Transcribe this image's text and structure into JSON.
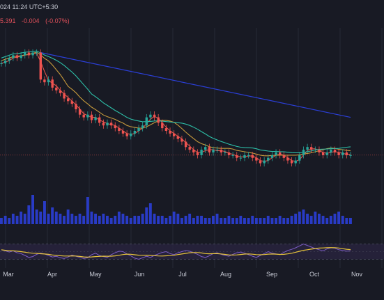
{
  "header": {
    "timestamp": "024 11:24 UTC+5:30",
    "last_price": "5.391",
    "change": "-0.004",
    "change_pct": "(-0.07%)"
  },
  "colors": {
    "background": "#181a24",
    "grid": "#262a36",
    "up": "#26a69a",
    "down": "#ef5350",
    "ma_fast": "#e2564c",
    "ma_mid": "#c69a3c",
    "ma_slow": "#2dbfa8",
    "trend": "#2b3fd8",
    "volume": "#2b3fd8",
    "rsi_line": "#7b5cc4",
    "rsi_ma": "#e8c53a",
    "rsi_band": "#2a2440",
    "price_line": "#ef5350",
    "axis_text": "#c9ccd6"
  },
  "chart_data": {
    "type": "candlestick",
    "x_axis": {
      "ticks": [
        "Mar",
        "Apr",
        "May",
        "Jun",
        "Jul",
        "Aug",
        "Sep",
        "Oct",
        "Nov"
      ]
    },
    "price": {
      "note": "no price scale visible; values are relative",
      "closes": [
        44,
        45,
        46,
        47,
        46,
        47,
        48,
        47,
        48,
        48,
        38,
        37,
        38,
        35,
        34,
        33,
        31,
        30,
        29,
        27,
        25,
        24,
        25,
        23,
        24,
        22,
        21,
        22,
        21,
        20,
        19,
        18,
        17,
        18,
        19,
        20,
        21,
        24,
        25,
        24,
        22,
        20,
        19,
        18,
        17,
        16,
        15,
        13,
        12,
        11,
        10,
        12,
        13,
        11,
        12,
        12,
        11,
        11,
        10,
        10,
        9,
        9,
        10,
        10,
        9,
        8,
        7,
        8,
        9,
        10,
        11,
        10,
        9,
        8,
        7,
        8,
        10,
        12,
        13,
        12,
        12,
        11,
        10,
        11,
        12,
        11,
        10,
        11,
        10,
        10
      ]
    },
    "series": [
      {
        "name": "",
        "role": "ma_fast"
      },
      {
        "name": "",
        "role": "ma_mid"
      },
      {
        "name": "",
        "role": "ma_slow"
      }
    ],
    "trendline": {
      "from": 10,
      "to": 14
    },
    "volume": [
      3,
      4,
      3,
      5,
      4,
      6,
      5,
      9,
      14,
      7,
      6,
      11,
      5,
      8,
      6,
      5,
      4,
      7,
      5,
      4,
      5,
      4,
      13,
      6,
      5,
      4,
      5,
      4,
      3,
      4,
      6,
      5,
      4,
      3,
      4,
      4,
      5,
      8,
      10,
      5,
      4,
      4,
      3,
      4,
      6,
      5,
      3,
      4,
      5,
      3,
      4,
      4,
      3,
      3,
      4,
      5,
      3,
      3,
      4,
      3,
      3,
      4,
      3,
      3,
      4,
      3,
      3,
      3,
      4,
      3,
      3,
      4,
      3,
      3,
      4,
      5,
      6,
      7,
      5,
      4,
      6,
      5,
      4,
      3,
      4,
      5,
      6,
      4,
      3,
      3
    ],
    "rsi": {
      "values": [
        55,
        52,
        49,
        52,
        47,
        45,
        40,
        35,
        37,
        43,
        46,
        44,
        40,
        36,
        38,
        34,
        32,
        36,
        41,
        38,
        35,
        32,
        34,
        42,
        46,
        40,
        37,
        35,
        42,
        47,
        51,
        50,
        44,
        39,
        33,
        30,
        34,
        38,
        35,
        40,
        44,
        48,
        50,
        45,
        42,
        47,
        50,
        53,
        51,
        47,
        43,
        37,
        35,
        39,
        45,
        47,
        43,
        40,
        38,
        43,
        47,
        49,
        46,
        42,
        38,
        35,
        40,
        45,
        50,
        46,
        44,
        42,
        48,
        53,
        56,
        60,
        65,
        70,
        66,
        62,
        58,
        55,
        52,
        57,
        60,
        59,
        55,
        53,
        51,
        52
      ],
      "upper": 70,
      "lower": 30,
      "ylim": [
        20,
        80
      ]
    }
  }
}
